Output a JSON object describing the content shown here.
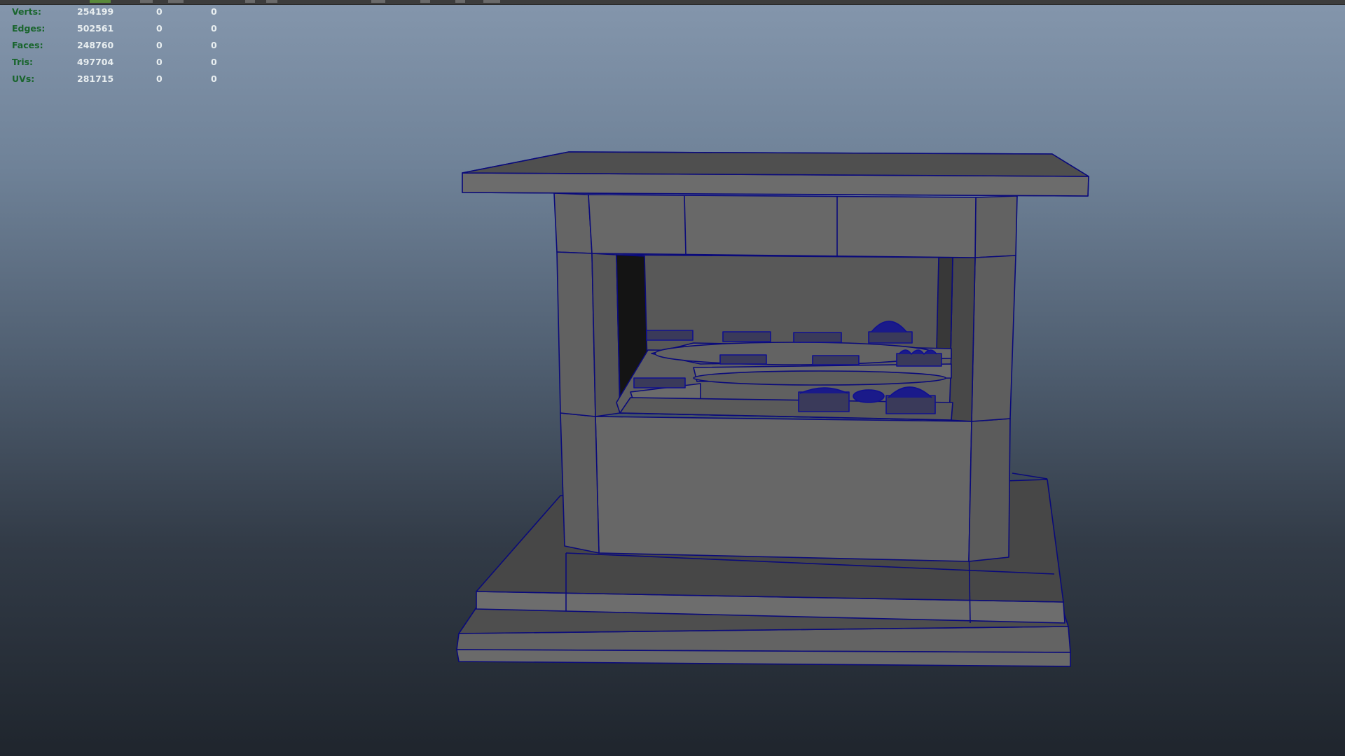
{
  "hud": {
    "rows": [
      {
        "label": "Verts:",
        "values": [
          "254199",
          "0",
          "0"
        ]
      },
      {
        "label": "Edges:",
        "values": [
          "502561",
          "0",
          "0"
        ]
      },
      {
        "label": "Faces:",
        "values": [
          "248760",
          "0",
          "0"
        ]
      },
      {
        "label": "Tris:",
        "values": [
          "497704",
          "0",
          "0"
        ]
      },
      {
        "label": "UVs:",
        "values": [
          "281715",
          "0",
          "0"
        ]
      }
    ]
  },
  "colors": {
    "label_green": "#19652d",
    "value_white": "#e8eef0",
    "wire_blue": "#0a0a7a",
    "mesh_gray": "#6a6a6a"
  },
  "viewport": {
    "content": "3d-kiosk-model-wireframe-on-shaded"
  }
}
